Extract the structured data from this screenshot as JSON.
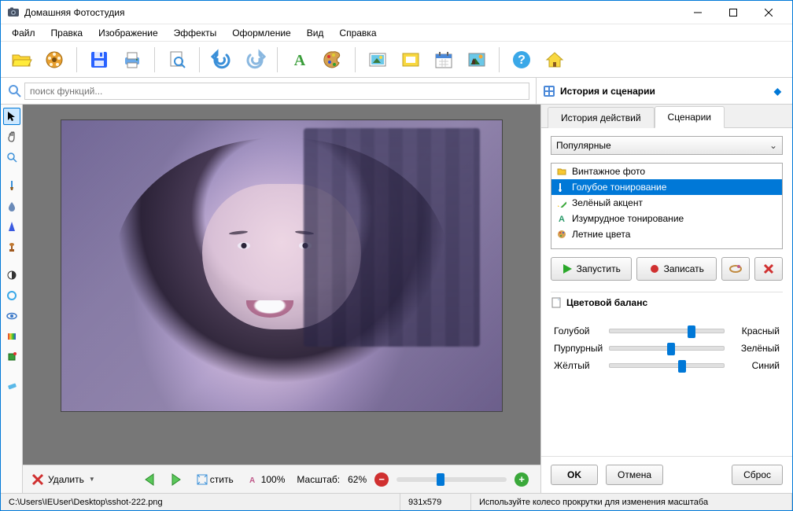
{
  "title": "Домашняя Фотостудия",
  "menu": [
    "Файл",
    "Правка",
    "Изображение",
    "Эффекты",
    "Оформление",
    "Вид",
    "Справка"
  ],
  "search_placeholder": "поиск функций...",
  "right_panel_title": "История и сценарии",
  "tabs": {
    "history": "История действий",
    "scenarios": "Сценарии"
  },
  "category": "Популярные",
  "scenarios": [
    {
      "label": "Винтажное фото",
      "icon": "folder"
    },
    {
      "label": "Голубое тонирование",
      "icon": "blue",
      "selected": true
    },
    {
      "label": "Зелёный акцент",
      "icon": "pencil"
    },
    {
      "label": "Изумрудное тонирование",
      "icon": "text"
    },
    {
      "label": "Летние цвета",
      "icon": "palette"
    }
  ],
  "buttons": {
    "run": "Запустить",
    "record": "Записать"
  },
  "color_balance_title": "Цветовой баланс",
  "balance": [
    {
      "left": "Голубой",
      "right": "Красный",
      "pos": 68
    },
    {
      "left": "Пурпурный",
      "right": "Зелёный",
      "pos": 50
    },
    {
      "left": "Жёлтый",
      "right": "Синий",
      "pos": 60
    }
  ],
  "footer": {
    "ok": "OK",
    "cancel": "Отмена",
    "reset": "Сброс"
  },
  "bottom": {
    "delete": "Удалить",
    "fit": "стить",
    "zoom100": "100%",
    "zoom_label": "Масштаб:",
    "zoom_value": "62%"
  },
  "status": {
    "path": "C:\\Users\\IEUser\\Desktop\\sshot-222.png",
    "dim": "931x579",
    "hint": "Используйте колесо прокрутки для изменения масштаба"
  }
}
